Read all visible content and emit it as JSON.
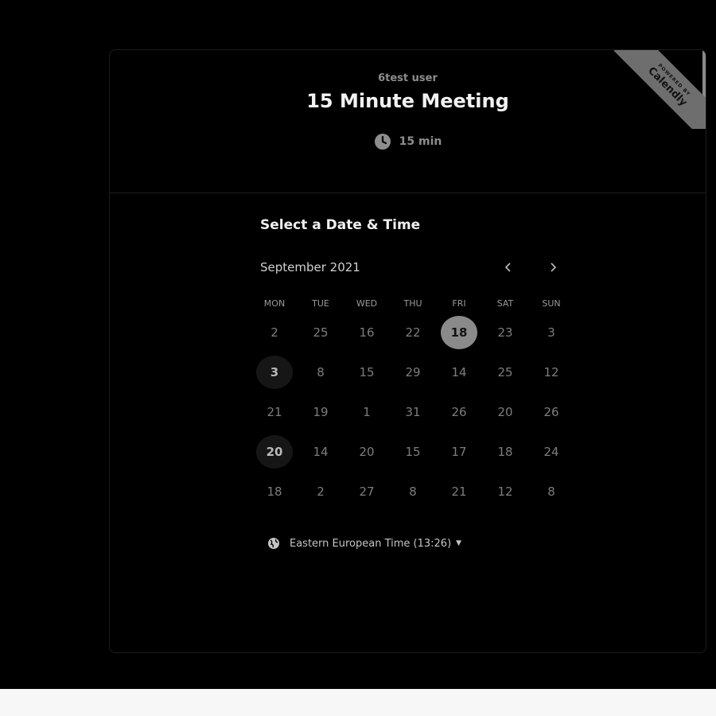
{
  "event": {
    "organizer": "6test user",
    "title": "15 Minute Meeting",
    "duration": "15 min",
    "clock_icon": "clock-icon"
  },
  "badge": {
    "powered_by": "POWERED BY",
    "brand": "Calendly"
  },
  "calendar": {
    "section_title": "Select a Date & Time",
    "month": "September 2021",
    "prev_icon": "chevron-left-icon",
    "next_icon": "chevron-right-icon",
    "weekdays": [
      "MON",
      "TUE",
      "WED",
      "THU",
      "FRI",
      "SAT",
      "SUN"
    ],
    "days": [
      {
        "label": "2",
        "state": "disabled"
      },
      {
        "label": "25",
        "state": "disabled"
      },
      {
        "label": "16",
        "state": "disabled"
      },
      {
        "label": "22",
        "state": "disabled"
      },
      {
        "label": "18",
        "state": "selected"
      },
      {
        "label": "23",
        "state": "disabled"
      },
      {
        "label": "3",
        "state": "disabled"
      },
      {
        "label": "3",
        "state": "available"
      },
      {
        "label": "8",
        "state": "disabled"
      },
      {
        "label": "15",
        "state": "disabled"
      },
      {
        "label": "29",
        "state": "disabled"
      },
      {
        "label": "14",
        "state": "disabled"
      },
      {
        "label": "25",
        "state": "disabled"
      },
      {
        "label": "12",
        "state": "disabled"
      },
      {
        "label": "21",
        "state": "disabled"
      },
      {
        "label": "19",
        "state": "disabled"
      },
      {
        "label": "1",
        "state": "disabled"
      },
      {
        "label": "31",
        "state": "disabled"
      },
      {
        "label": "26",
        "state": "disabled"
      },
      {
        "label": "20",
        "state": "disabled"
      },
      {
        "label": "26",
        "state": "disabled"
      },
      {
        "label": "20",
        "state": "available"
      },
      {
        "label": "14",
        "state": "disabled"
      },
      {
        "label": "20",
        "state": "disabled"
      },
      {
        "label": "15",
        "state": "disabled"
      },
      {
        "label": "17",
        "state": "disabled"
      },
      {
        "label": "18",
        "state": "disabled"
      },
      {
        "label": "24",
        "state": "disabled"
      },
      {
        "label": "18",
        "state": "disabled"
      },
      {
        "label": "2",
        "state": "disabled"
      },
      {
        "label": "27",
        "state": "disabled"
      },
      {
        "label": "8",
        "state": "disabled"
      },
      {
        "label": "21",
        "state": "disabled"
      },
      {
        "label": "12",
        "state": "disabled"
      },
      {
        "label": "8",
        "state": "disabled"
      }
    ]
  },
  "timezone": {
    "label": "Eastern European Time (13:26)",
    "icon": "globe-icon"
  },
  "colors": {
    "background": "#000000",
    "selected_day": "#8a8a8a",
    "available_day": "#161616",
    "ribbon": "#6e6e6e"
  }
}
